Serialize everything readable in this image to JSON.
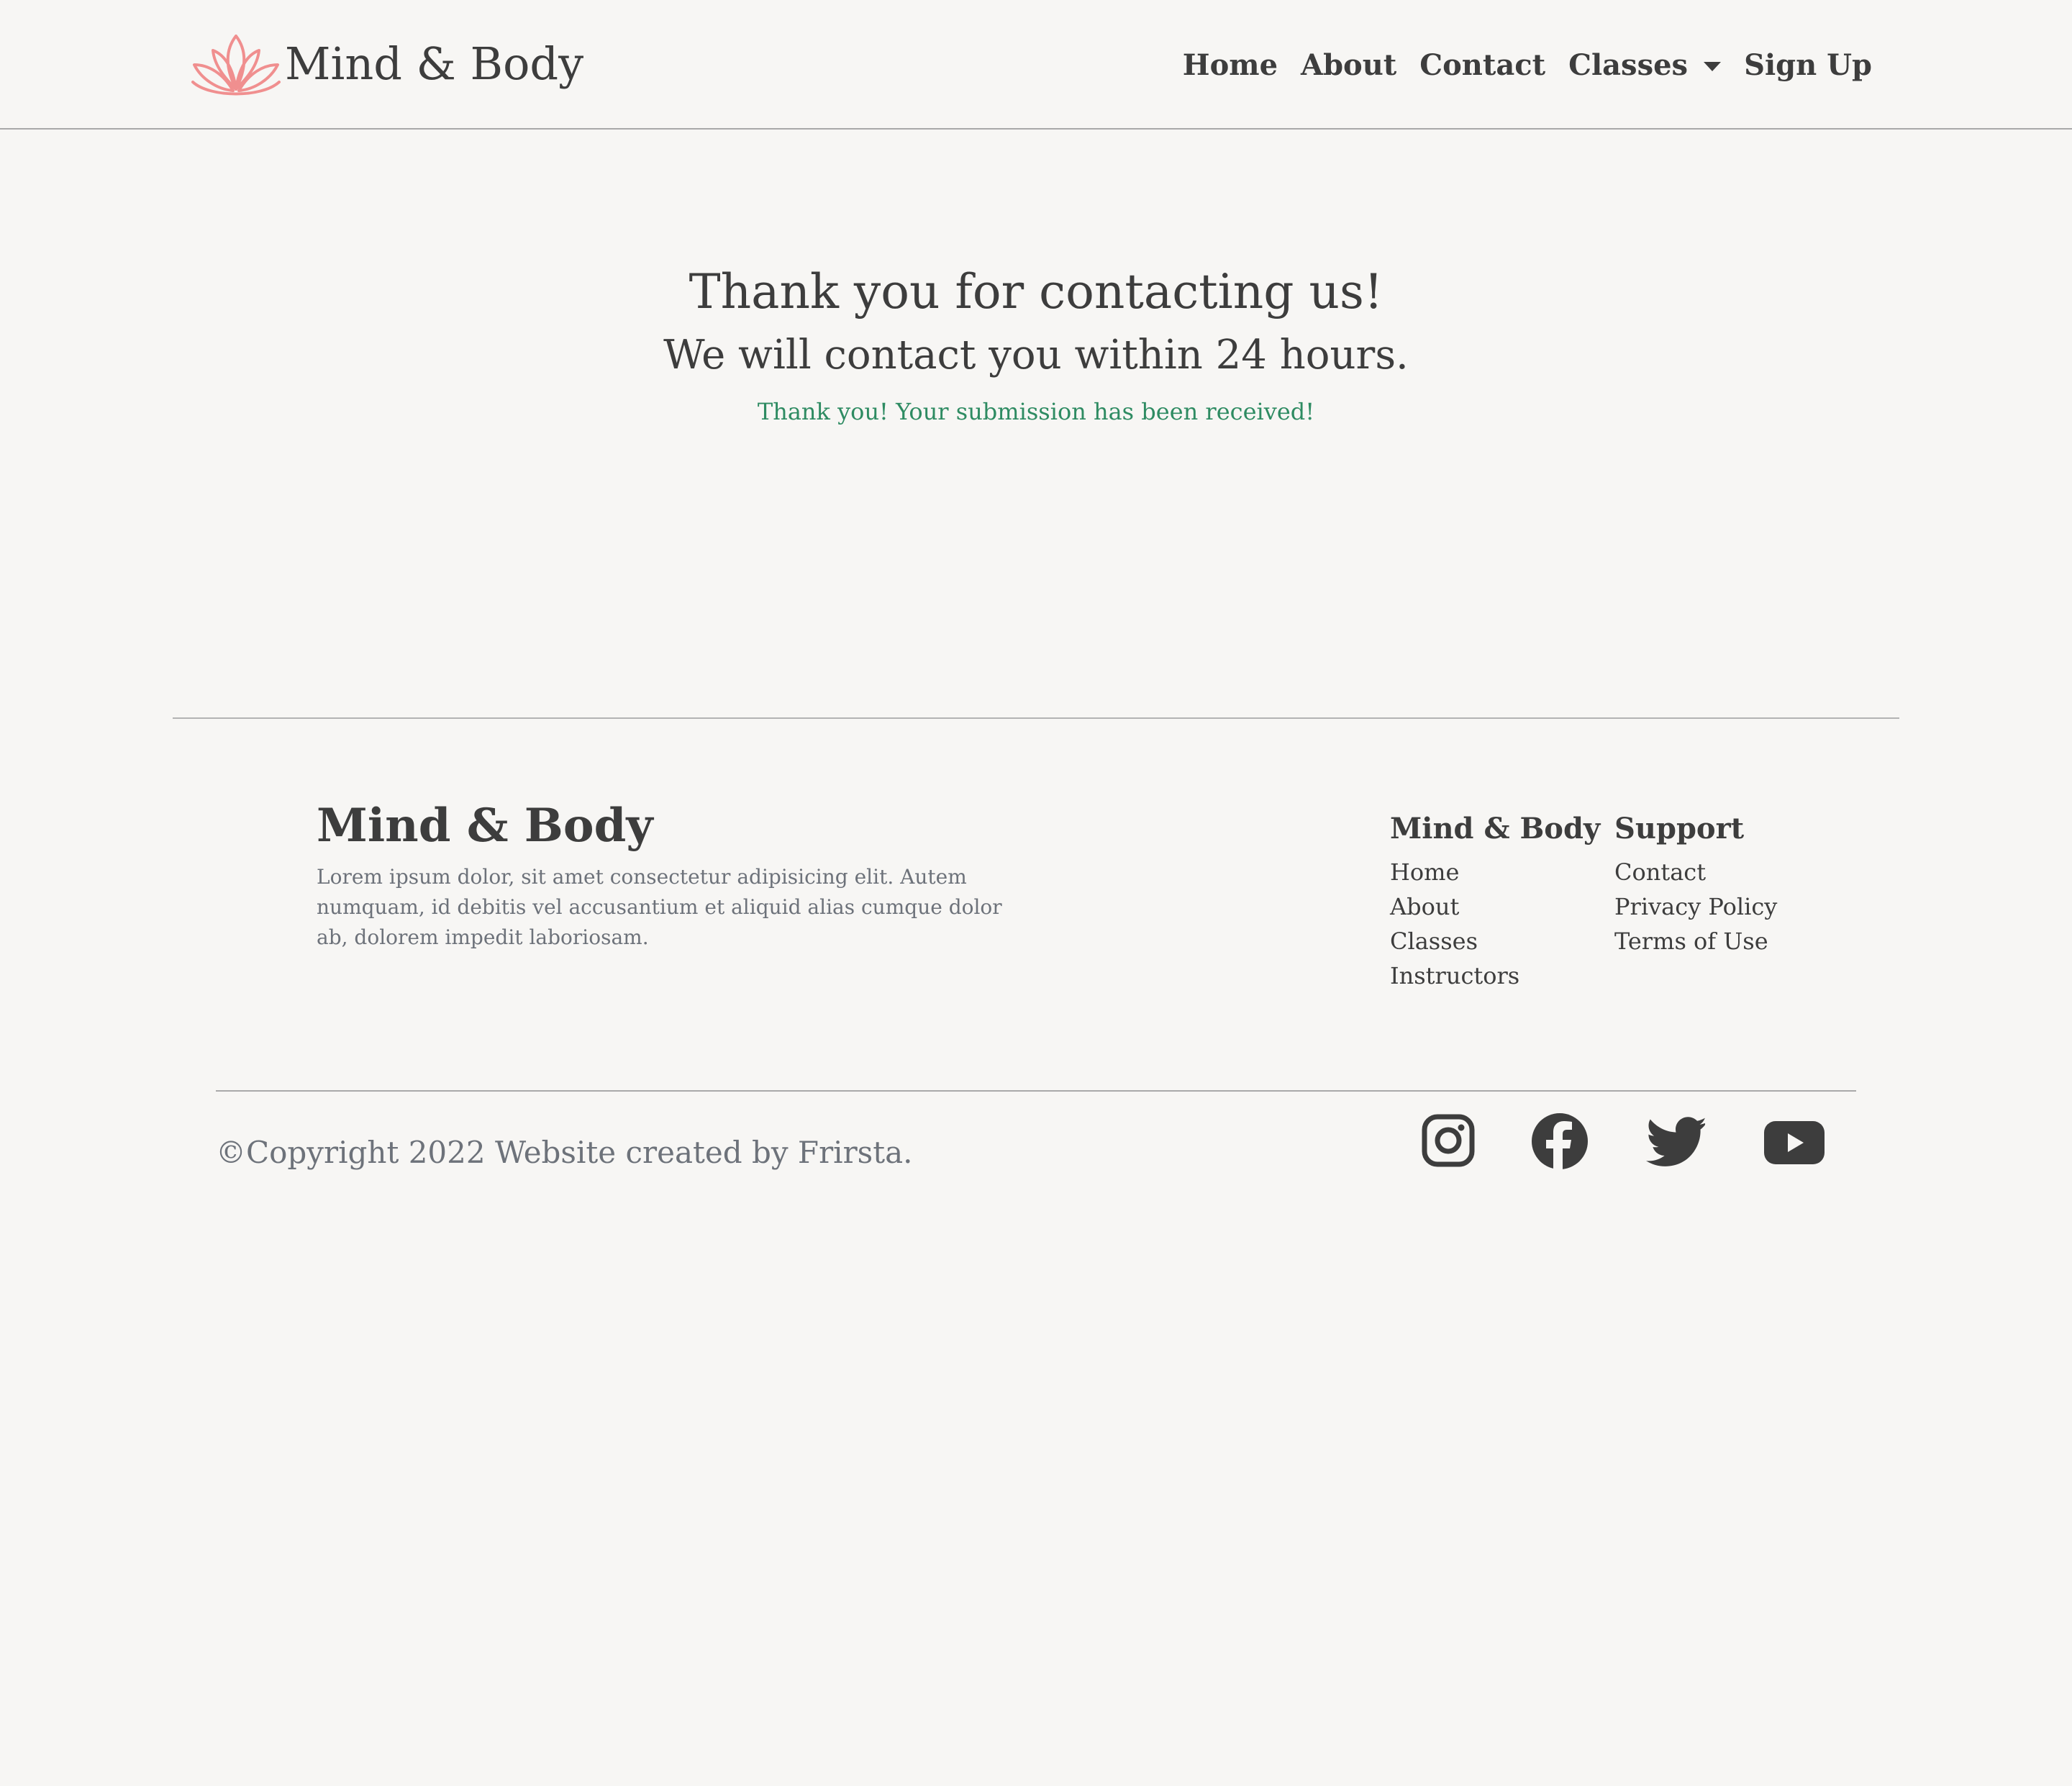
{
  "navbar": {
    "brand": "Mind & Body",
    "logo_icon": "lotus-icon",
    "logo_color": "#f08f8f",
    "links": {
      "home": "Home",
      "about": "About",
      "contact": "Contact",
      "classes": "Classes",
      "signup": "Sign Up"
    }
  },
  "thanks": {
    "title": "Thank you for contacting us!",
    "subtitle": "We will contact you within 24 hours.",
    "success_message": "Thank you! Your submission has been received!",
    "success_color": "#2e8b62"
  },
  "footer": {
    "brand": "Mind & Body",
    "description": "Lorem ipsum dolor, sit amet consectetur adipisicing elit. Autem numquam, id debitis vel accusantium et aliquid alias cumque dolor ab, dolorem impedit laboriosam.",
    "columns": [
      {
        "title": "Mind & Body",
        "links": [
          "Home",
          "About",
          "Classes",
          "Instructors"
        ]
      },
      {
        "title": "Support",
        "links": [
          "Contact",
          "Privacy Policy",
          "Terms of Use"
        ]
      }
    ],
    "copyright": "©Copyright 2022 Website created by Frirsta.",
    "social_icons": [
      "instagram-icon",
      "facebook-icon",
      "twitter-icon",
      "youtube-icon"
    ]
  }
}
